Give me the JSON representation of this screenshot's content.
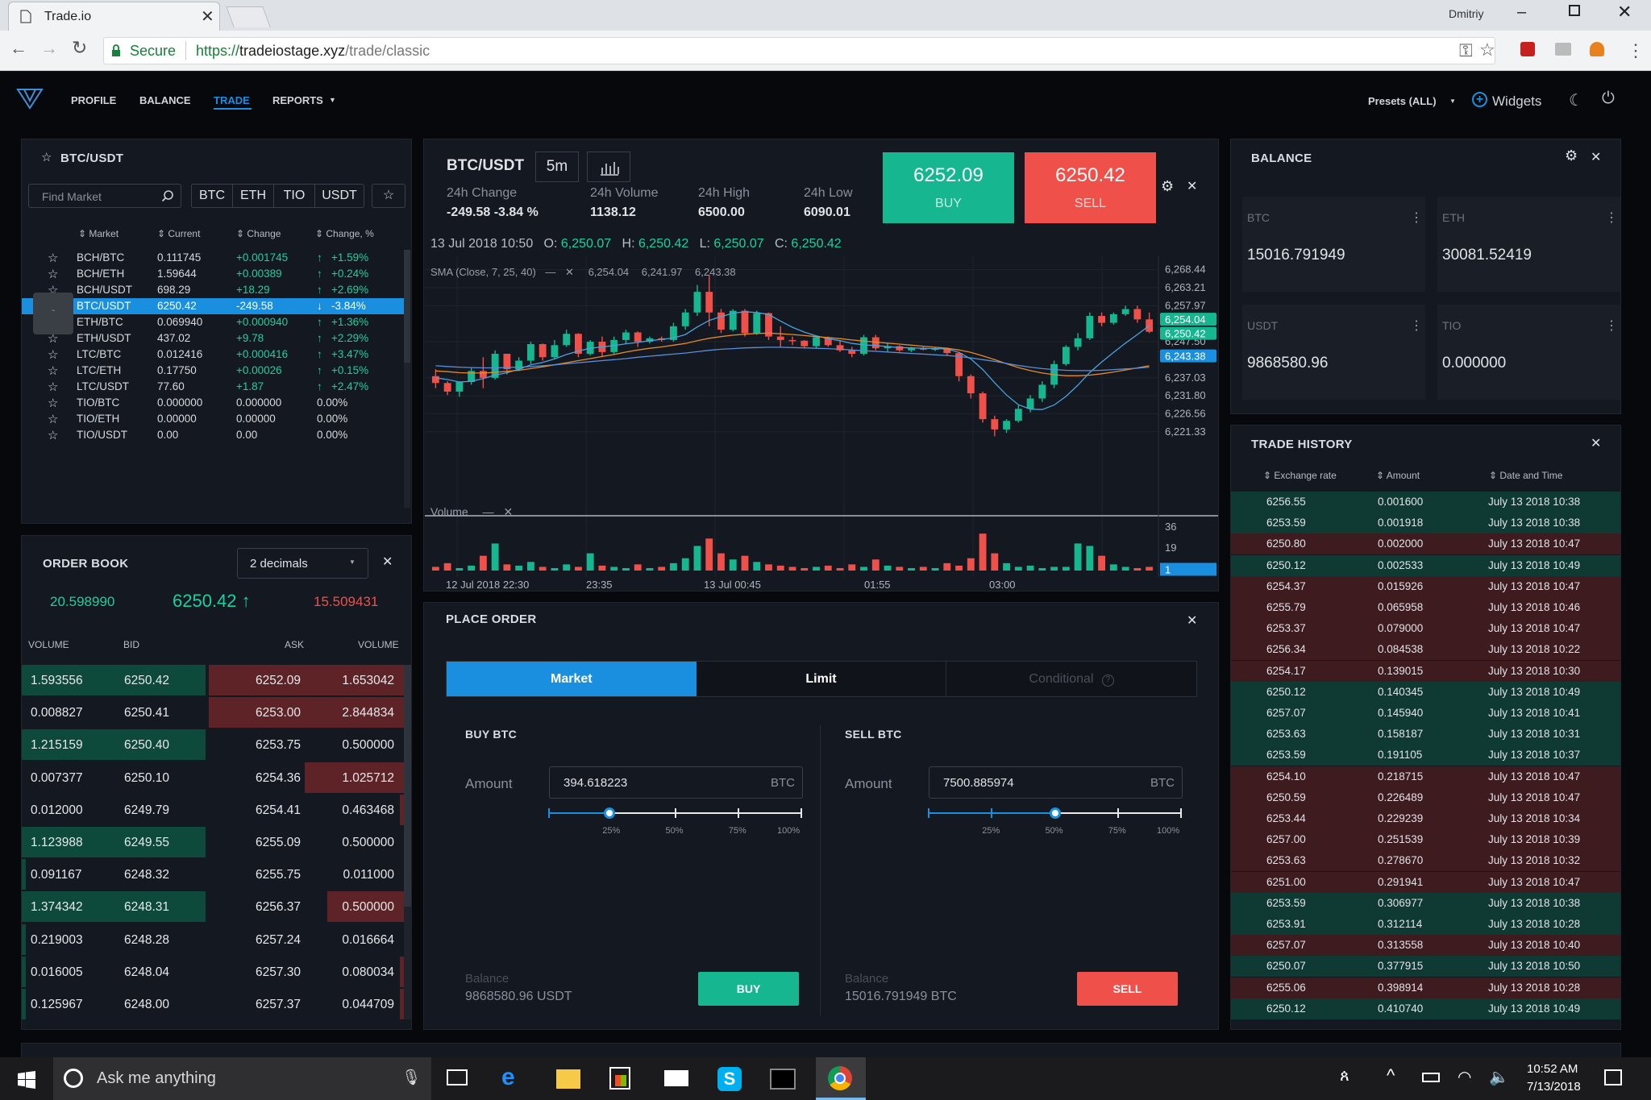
{
  "browser": {
    "tab_title": "Trade.io",
    "user": "Dmitriy",
    "secure_label": "Secure",
    "url_prefix": "https://",
    "url_domain": "tradeiostage.xyz",
    "url_path": "/trade/classic"
  },
  "nav": {
    "items": [
      "PROFILE",
      "BALANCE",
      "TRADE",
      "REPORTS"
    ],
    "active": "TRADE",
    "presets": "Presets (ALL)",
    "widgets": "Widgets"
  },
  "markets": {
    "title": "BTC/USDT",
    "search_placeholder": "Find Market",
    "filters": [
      "BTC",
      "ETH",
      "TIO",
      "USDT"
    ],
    "columns": [
      "Market",
      "Current",
      "Change",
      "Change, %"
    ],
    "rows": [
      {
        "market": "BCH/BTC",
        "current": "0.111745",
        "change": "+0.001745",
        "pct": "+1.59%",
        "dir": "up"
      },
      {
        "market": "BCH/ETH",
        "current": "1.59644",
        "change": "+0.00389",
        "pct": "+0.24%",
        "dir": "up"
      },
      {
        "market": "BCH/USDT",
        "current": "698.29",
        "change": "+18.29",
        "pct": "+2.69%",
        "dir": "up"
      },
      {
        "market": "BTC/USDT",
        "current": "6250.42",
        "change": "-249.58",
        "pct": "-3.84%",
        "dir": "down",
        "selected": true
      },
      {
        "market": "ETH/BTC",
        "current": "0.069940",
        "change": "+0.000940",
        "pct": "+1.36%",
        "dir": "up"
      },
      {
        "market": "ETH/USDT",
        "current": "437.02",
        "change": "+9.78",
        "pct": "+2.29%",
        "dir": "up"
      },
      {
        "market": "LTC/BTC",
        "current": "0.012416",
        "change": "+0.000416",
        "pct": "+3.47%",
        "dir": "up"
      },
      {
        "market": "LTC/ETH",
        "current": "0.17750",
        "change": "+0.00026",
        "pct": "+0.15%",
        "dir": "up"
      },
      {
        "market": "LTC/USDT",
        "current": "77.60",
        "change": "+1.87",
        "pct": "+2.47%",
        "dir": "up"
      },
      {
        "market": "TIO/BTC",
        "current": "0.000000",
        "change": "0.000000",
        "pct": "0.00%",
        "dir": "none"
      },
      {
        "market": "TIO/ETH",
        "current": "0.00000",
        "change": "0.00000",
        "pct": "0.00%",
        "dir": "none"
      },
      {
        "market": "TIO/USDT",
        "current": "0.00",
        "change": "0.00",
        "pct": "0.00%",
        "dir": "none"
      }
    ]
  },
  "chart_header": {
    "pair": "BTC/USDT",
    "interval": "5m",
    "stats": [
      {
        "label": "24h Change",
        "value": "-249.58 -3.84 %"
      },
      {
        "label": "24h Volume",
        "value": "1138.12"
      },
      {
        "label": "24h High",
        "value": "6500.00"
      },
      {
        "label": "24h Low",
        "value": "6090.01"
      }
    ],
    "buy_price": "6252.09",
    "buy_label": "BUY",
    "sell_price": "6250.42",
    "sell_label": "SELL",
    "ohlc_date": "13 Jul 2018 10:50",
    "ohlc": {
      "O": "6,250.07",
      "H": "6,250.42",
      "L": "6,250.07",
      "C": "6,250.42"
    },
    "sma_label": "SMA (Close, 7, 25, 40)",
    "sma_values": [
      "6,254.04",
      "6,241.97",
      "6,243.38"
    ],
    "volume_label": "Volume"
  },
  "chart_data": {
    "type": "candlestick",
    "y_ticks": [
      "6,268.44",
      "6,263.21",
      "6,257.97",
      "6,247.50",
      "6,237.03",
      "6,231.80",
      "6,226.56",
      "6,221.33"
    ],
    "y_markers": [
      "6,254.04",
      "6,250.42",
      "6,243.38"
    ],
    "ylim": [
      6218,
      6270
    ],
    "x_ticks": [
      "12 Jul 2018 22:30",
      "23:35",
      "13 Jul 00:45",
      "01:55",
      "03:00"
    ],
    "volume_ticks": [
      "36",
      "19",
      "1"
    ],
    "candles": [
      [
        6237.5,
        6239.5,
        6234,
        6235.5
      ],
      [
        6235.5,
        6236,
        6232,
        6233
      ],
      [
        6233,
        6236,
        6231.5,
        6235.8
      ],
      [
        6235.8,
        6240,
        6235,
        6239
      ],
      [
        6239,
        6243,
        6234,
        6237
      ],
      [
        6237,
        6245,
        6236.5,
        6244
      ],
      [
        6244,
        6244,
        6238,
        6239.5
      ],
      [
        6239.5,
        6243,
        6239,
        6242
      ],
      [
        6242,
        6247.5,
        6241,
        6246.8
      ],
      [
        6246.8,
        6247,
        6242,
        6243
      ],
      [
        6243,
        6248,
        6242.5,
        6246.5
      ],
      [
        6246.5,
        6251,
        6246,
        6249.8
      ],
      [
        6249.8,
        6250,
        6243,
        6244
      ],
      [
        6244,
        6248,
        6243.5,
        6247.5
      ],
      [
        6247.5,
        6249,
        6243,
        6244.5
      ],
      [
        6244.5,
        6249,
        6244,
        6248
      ],
      [
        6248,
        6251,
        6247,
        6250.2
      ],
      [
        6250.2,
        6250.5,
        6246,
        6247.5
      ],
      [
        6247.5,
        6249,
        6247,
        6248.5
      ],
      [
        6248.5,
        6249,
        6247.5,
        6248
      ],
      [
        6248,
        6253,
        6247.5,
        6252
      ],
      [
        6252,
        6257,
        6251,
        6256
      ],
      [
        6256,
        6264,
        6255,
        6262
      ],
      [
        6262,
        6267,
        6252,
        6256
      ],
      [
        6256,
        6257,
        6250,
        6251
      ],
      [
        6251,
        6257,
        6250.5,
        6256.5
      ],
      [
        6256.5,
        6257,
        6249,
        6250
      ],
      [
        6250,
        6256.5,
        6249.5,
        6255.8
      ],
      [
        6255.8,
        6256,
        6248,
        6249
      ],
      [
        6249,
        6252,
        6246,
        6248
      ],
      [
        6248,
        6249,
        6246.5,
        6247.8
      ],
      [
        6247.8,
        6248,
        6245.5,
        6246.2
      ],
      [
        6246.2,
        6249,
        6245.5,
        6248.8
      ],
      [
        6248.8,
        6249,
        6246,
        6246.5
      ],
      [
        6246.5,
        6248,
        6244.5,
        6245
      ],
      [
        6245,
        6246,
        6243,
        6244
      ],
      [
        6244,
        6249.5,
        6243.5,
        6248.8
      ],
      [
        6248.8,
        6249.5,
        6245,
        6245.6
      ],
      [
        6245.6,
        6247,
        6244.5,
        6246.2
      ],
      [
        6246.2,
        6246.5,
        6244.6,
        6245
      ],
      [
        6245,
        6246,
        6244.5,
        6245.6
      ],
      [
        6245.6,
        6246,
        6245,
        6245.2
      ],
      [
        6245.2,
        6246,
        6244.8,
        6245.5
      ],
      [
        6245.5,
        6245.8,
        6243.5,
        6244.2
      ],
      [
        6244.2,
        6244.6,
        6236,
        6237.5
      ],
      [
        6237.5,
        6238,
        6231,
        6232.5
      ],
      [
        6232.5,
        6233,
        6224,
        6225
      ],
      [
        6225,
        6226,
        6220,
        6222
      ],
      [
        6222,
        6225,
        6221,
        6224.5
      ],
      [
        6224.5,
        6229,
        6224,
        6228
      ],
      [
        6228,
        6232,
        6227,
        6231
      ],
      [
        6231,
        6236,
        6230,
        6235
      ],
      [
        6235,
        6242,
        6234,
        6241
      ],
      [
        6241,
        6246.5,
        6240.5,
        6246
      ],
      [
        6246,
        6250,
        6245,
        6248.5
      ],
      [
        6248.5,
        6256,
        6248,
        6255
      ],
      [
        6255,
        6256,
        6252,
        6253
      ],
      [
        6253,
        6256,
        6252.5,
        6255.5
      ],
      [
        6255.5,
        6258,
        6255,
        6257
      ],
      [
        6257,
        6258,
        6253,
        6254
      ],
      [
        6254,
        6256,
        6250,
        6250.4
      ]
    ],
    "volumes": [
      3,
      6,
      2,
      4,
      12,
      22,
      5,
      4,
      7,
      3,
      2,
      5,
      3,
      14,
      4,
      3,
      2,
      5,
      2,
      3,
      6,
      10,
      20,
      26,
      14,
      9,
      12,
      7,
      5,
      4,
      3,
      2,
      3,
      4,
      2,
      5,
      3,
      9,
      4,
      3,
      2,
      3,
      2,
      6,
      4,
      10,
      30,
      14,
      6,
      3,
      4,
      2,
      3,
      3,
      22,
      20,
      12,
      5,
      3,
      2,
      3
    ],
    "sma7": [
      6237,
      6236.5,
      6235.8,
      6236,
      6236.8,
      6237.8,
      6238.5,
      6239.5,
      6240.8,
      6241.5,
      6242.5,
      6243.8,
      6244.8,
      6245.6,
      6246,
      6246.4,
      6246.9,
      6247.3,
      6247.8,
      6248.2,
      6248.6,
      6249.6,
      6251.8,
      6253.7,
      6254.8,
      6255.8,
      6256.2,
      6256,
      6255.4,
      6253.5,
      6251.7,
      6250.3,
      6249.2,
      6248.4,
      6247.8,
      6247,
      6246.6,
      6246.4,
      6246.1,
      6245.8,
      6245.7,
      6245.6,
      6245.5,
      6245.4,
      6244.4,
      6242.5,
      6239.4,
      6235.6,
      6232,
      6229.2,
      6227.9,
      6227.8,
      6229.1,
      6231.6,
      6234.9,
      6238.6,
      6241.6,
      6244.4,
      6247.1,
      6249.6,
      6252.2
    ],
    "sma25": [
      6239,
      6238.8,
      6238.5,
      6238.4,
      6238.4,
      6238.6,
      6238.9,
      6239.2,
      6239.7,
      6240.2,
      6240.8,
      6241.4,
      6242,
      6242.6,
      6243.2,
      6243.8,
      6244.5,
      6245.1,
      6245.6,
      6246,
      6246.5,
      6247,
      6247.8,
      6248.5,
      6249,
      6249.4,
      6249.7,
      6249.9,
      6250,
      6249.8,
      6249.6,
      6249.3,
      6249,
      6248.7,
      6248.4,
      6248,
      6247.7,
      6247.4,
      6247.1,
      6246.8,
      6246.5,
      6246.2,
      6245.9,
      6245.6,
      6245.1,
      6244.4,
      6243.4,
      6242.3,
      6241.1,
      6240,
      6239.1,
      6238.4,
      6237.9,
      6237.6,
      6237.6,
      6237.8,
      6238.2,
      6238.7,
      6239.3,
      6239.9,
      6240.5
    ],
    "sma40": [
      6240.5,
      6240.3,
      6240.1,
      6240,
      6239.9,
      6239.9,
      6240,
      6240.1,
      6240.3,
      6240.5,
      6240.8,
      6241.1,
      6241.4,
      6241.7,
      6242,
      6242.3,
      6242.6,
      6243,
      6243.3,
      6243.6,
      6243.9,
      6244.2,
      6244.6,
      6245,
      6245.3,
      6245.5,
      6245.7,
      6245.8,
      6245.9,
      6245.9,
      6245.8,
      6245.7,
      6245.6,
      6245.5,
      6245.3,
      6245.1,
      6244.9,
      6244.7,
      6244.5,
      6244.3,
      6244.1,
      6243.9,
      6243.7,
      6243.5,
      6243.2,
      6242.8,
      6242.3,
      6241.8,
      6241.2,
      6240.6,
      6240.1,
      6239.7,
      6239.4,
      6239.2,
      6239.1,
      6239.1,
      6239.2,
      6239.4,
      6239.6,
      6239.8,
      6240.1
    ]
  },
  "balance": {
    "title": "BALANCE",
    "assets": [
      {
        "name": "BTC",
        "value": "15016.791949"
      },
      {
        "name": "ETH",
        "value": "30081.52419"
      },
      {
        "name": "USDT",
        "value": "9868580.96"
      },
      {
        "name": "TIO",
        "value": "0.000000"
      }
    ]
  },
  "order_book": {
    "title": "ORDER BOOK",
    "decimals": "2 decimals",
    "left_total": "20.598990",
    "last_price": "6250.42",
    "right_total": "15.509431",
    "columns": [
      "VOLUME",
      "BID",
      "ASK",
      "VOLUME"
    ],
    "rows": [
      {
        "bid_vol": "1.593556",
        "bid": "6250.42",
        "ask": "6252.09",
        "ask_vol": "1.653042",
        "bid_fill": 0.48,
        "ask_fill": 0.51
      },
      {
        "bid_vol": "0.008827",
        "bid": "6250.41",
        "ask": "6253.00",
        "ask_vol": "2.844834",
        "bid_fill": 0.0,
        "ask_fill": 0.51
      },
      {
        "bid_vol": "1.215159",
        "bid": "6250.40",
        "ask": "6253.75",
        "ask_vol": "0.500000",
        "bid_fill": 0.48,
        "ask_fill": 0.0
      },
      {
        "bid_vol": "0.007377",
        "bid": "6250.10",
        "ask": "6254.36",
        "ask_vol": "1.025712",
        "bid_fill": 0.0,
        "ask_fill": 0.26
      },
      {
        "bid_vol": "0.012000",
        "bid": "6249.79",
        "ask": "6254.41",
        "ask_vol": "0.463468",
        "bid_fill": 0.0,
        "ask_fill": 0.01
      },
      {
        "bid_vol": "1.123988",
        "bid": "6249.55",
        "ask": "6255.09",
        "ask_vol": "0.500000",
        "bid_fill": 0.48,
        "ask_fill": 0.0
      },
      {
        "bid_vol": "0.091167",
        "bid": "6248.32",
        "ask": "6255.75",
        "ask_vol": "0.011000",
        "bid_fill": 0.01,
        "ask_fill": 0.0
      },
      {
        "bid_vol": "1.374342",
        "bid": "6248.31",
        "ask": "6256.37",
        "ask_vol": "0.500000",
        "bid_fill": 0.48,
        "ask_fill": 0.2
      },
      {
        "bid_vol": "0.219003",
        "bid": "6248.28",
        "ask": "6257.24",
        "ask_vol": "0.016664",
        "bid_fill": 0.01,
        "ask_fill": 0.0
      },
      {
        "bid_vol": "0.016005",
        "bid": "6248.04",
        "ask": "6257.30",
        "ask_vol": "0.080034",
        "bid_fill": 0.01,
        "ask_fill": 0.01
      },
      {
        "bid_vol": "0.125967",
        "bid": "6248.00",
        "ask": "6257.37",
        "ask_vol": "0.044709",
        "bid_fill": 0.01,
        "ask_fill": 0.01
      }
    ]
  },
  "place_order": {
    "title": "PLACE ORDER",
    "tabs": [
      "Market",
      "Limit",
      "Conditional"
    ],
    "buy": {
      "title": "BUY BTC",
      "amount_label": "Amount",
      "amount": "394.618223",
      "unit": "BTC",
      "balance_label": "Balance",
      "balance": "9868580.96 USDT",
      "button": "BUY",
      "slider": 0.24
    },
    "sell": {
      "title": "SELL BTC",
      "amount_label": "Amount",
      "amount": "7500.885974",
      "unit": "BTC",
      "balance_label": "Balance",
      "balance": "15016.791949 BTC",
      "button": "SELL",
      "slider": 0.5
    },
    "ticks": [
      "25%",
      "50%",
      "75%",
      "100%"
    ]
  },
  "trade_history": {
    "title": "TRADE HISTORY",
    "columns": [
      "Exchange rate",
      "Amount",
      "Date and Time"
    ],
    "rows": [
      {
        "rate": "6256.55",
        "amount": "0.001600",
        "time": "July 13 2018 10:38",
        "side": "buy"
      },
      {
        "rate": "6253.59",
        "amount": "0.001918",
        "time": "July 13 2018 10:38",
        "side": "buy"
      },
      {
        "rate": "6250.80",
        "amount": "0.002000",
        "time": "July 13 2018 10:47",
        "side": "sell"
      },
      {
        "rate": "6250.12",
        "amount": "0.002533",
        "time": "July 13 2018 10:49",
        "side": "buy"
      },
      {
        "rate": "6254.37",
        "amount": "0.015926",
        "time": "July 13 2018 10:47",
        "side": "sell"
      },
      {
        "rate": "6255.79",
        "amount": "0.065958",
        "time": "July 13 2018 10:46",
        "side": "sell"
      },
      {
        "rate": "6253.37",
        "amount": "0.079000",
        "time": "July 13 2018 10:47",
        "side": "sell"
      },
      {
        "rate": "6256.34",
        "amount": "0.084538",
        "time": "July 13 2018 10:22",
        "side": "sell"
      },
      {
        "rate": "6254.17",
        "amount": "0.139015",
        "time": "July 13 2018 10:30",
        "side": "sell"
      },
      {
        "rate": "6250.12",
        "amount": "0.140345",
        "time": "July 13 2018 10:49",
        "side": "buy"
      },
      {
        "rate": "6257.07",
        "amount": "0.145940",
        "time": "July 13 2018 10:41",
        "side": "buy"
      },
      {
        "rate": "6253.63",
        "amount": "0.158187",
        "time": "July 13 2018 10:31",
        "side": "buy"
      },
      {
        "rate": "6253.59",
        "amount": "0.191105",
        "time": "July 13 2018 10:37",
        "side": "buy"
      },
      {
        "rate": "6254.10",
        "amount": "0.218715",
        "time": "July 13 2018 10:47",
        "side": "sell"
      },
      {
        "rate": "6250.59",
        "amount": "0.226489",
        "time": "July 13 2018 10:47",
        "side": "sell"
      },
      {
        "rate": "6253.44",
        "amount": "0.229239",
        "time": "July 13 2018 10:34",
        "side": "sell"
      },
      {
        "rate": "6257.00",
        "amount": "0.251539",
        "time": "July 13 2018 10:39",
        "side": "sell"
      },
      {
        "rate": "6253.63",
        "amount": "0.278670",
        "time": "July 13 2018 10:32",
        "side": "sell"
      },
      {
        "rate": "6251.00",
        "amount": "0.291941",
        "time": "July 13 2018 10:47",
        "side": "sell"
      },
      {
        "rate": "6253.59",
        "amount": "0.306977",
        "time": "July 13 2018 10:38",
        "side": "buy"
      },
      {
        "rate": "6253.91",
        "amount": "0.312114",
        "time": "July 13 2018 10:28",
        "side": "buy"
      },
      {
        "rate": "6257.07",
        "amount": "0.313558",
        "time": "July 13 2018 10:40",
        "side": "sell"
      },
      {
        "rate": "6250.07",
        "amount": "0.377915",
        "time": "July 13 2018 10:50",
        "side": "buy"
      },
      {
        "rate": "6255.06",
        "amount": "0.398914",
        "time": "July 13 2018 10:28",
        "side": "sell"
      },
      {
        "rate": "6250.12",
        "amount": "0.410740",
        "time": "July 13 2018 10:49",
        "side": "buy"
      }
    ]
  },
  "taskbar": {
    "search_placeholder": "Ask me anything",
    "time": "10:52 AM",
    "date": "7/13/2018"
  },
  "colors": {
    "buy": "#15b690",
    "sell": "#f0504a",
    "accent": "#1a8fe0",
    "bg": "#06080b",
    "panel": "#141820"
  }
}
